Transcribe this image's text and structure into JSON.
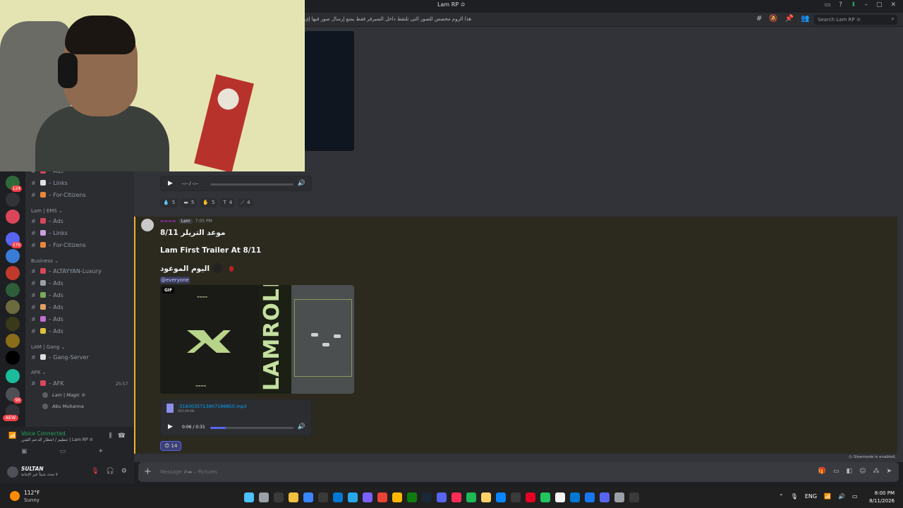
{
  "window": {
    "title": "Lam RP ♔",
    "controls": [
      "inbox-icon",
      "help-icon",
      "download-icon",
      "minimize-icon",
      "maximize-icon",
      "close-icon"
    ]
  },
  "header": {
    "topic": "هذا الروم مخصص للصور التي تلتقط داخل السيرفر فقط يمنع إرسال صور فيها إي",
    "icons": [
      "threads-icon",
      "mute-icon",
      "pin-icon",
      "members-icon"
    ],
    "search_placeholder": "Search Lam RP ♔"
  },
  "rail": {
    "badges": [
      "124",
      "376",
      "96"
    ],
    "new_label": "NEW"
  },
  "sidebar": {
    "top_channels": [
      {
        "label": "– Ads",
        "color": "#d9465a"
      },
      {
        "label": "– Links",
        "color": "#e0e0e0"
      },
      {
        "label": "– For-Citizens",
        "color": "#e8873a"
      }
    ],
    "categories": [
      {
        "name": "Lam | EMS",
        "channels": [
          {
            "label": "– Ads",
            "color": "#d9465a"
          },
          {
            "label": "– Links",
            "color": "#c9a0dc"
          },
          {
            "label": "– For-Citizens",
            "color": "#e8873a"
          }
        ]
      },
      {
        "name": "Business",
        "channels": [
          {
            "label": "– ALTAYYAN-Luxury",
            "color": "#d9465a"
          },
          {
            "label": "– Ads",
            "color": "#9aa0a6"
          },
          {
            "label": "– Ads",
            "color": "#7da95a"
          },
          {
            "label": "– Ads",
            "color": "#e0a060"
          },
          {
            "label": "– Ads",
            "color": "#c070d0"
          },
          {
            "label": "– Ads",
            "color": "#e0c040"
          }
        ]
      },
      {
        "name": "LAM | Gang",
        "channels": [
          {
            "label": "– Gang-Server",
            "color": "#dddddd"
          }
        ]
      },
      {
        "name": "AFK",
        "channels": [
          {
            "label": "– AFK",
            "color": "#d9465a"
          }
        ]
      }
    ],
    "afk_time": "25:57",
    "voice_users": [
      "Lam | Magic ♔",
      "Abu Muhanna"
    ]
  },
  "voice": {
    "status": "Voice Connected",
    "detail": "تنظيم / انتظار الدعم الفني | Lam RP ♔"
  },
  "user": {
    "name": "SULTAN",
    "status": "لا تحدد شيئاً غير الإجابة"
  },
  "messages": {
    "prev_audio": {
      "time": "-:-- / -:--",
      "progress": 0.0
    },
    "prev_reactions": [
      {
        "icon": "💧",
        "count": "5"
      },
      {
        "icon": "▬",
        "count": "5"
      },
      {
        "icon": "✋",
        "count": "5"
      },
      {
        "icon": "T",
        "count": "4"
      },
      {
        "icon": "⟋",
        "count": "4"
      }
    ],
    "highlight": {
      "tag": "Lam",
      "time": "7:05 PM",
      "line1": "موعد التريلر 8/11",
      "line2": "Lam First Trailer At 8/11",
      "line3": "اليوم الموعود",
      "mention": "@everyone",
      "gif_tag": "GIF",
      "gif_brand": "LAMROLE",
      "attachment": {
        "filename": "-3183035713907196850.mp3",
        "size": "691.09 KB",
        "time": "0:06 / 0:31",
        "progress": 0.19
      },
      "reaction": {
        "icon": "😊",
        "count": "14"
      }
    }
  },
  "composer": {
    "slowmode": "Slowmode is enabled.",
    "placeholder": "Message #▬ – Pictures",
    "icons": [
      "gift-icon",
      "gif-icon",
      "sticker-icon",
      "emoji-icon",
      "apps-icon",
      "send-icon"
    ]
  },
  "taskbar": {
    "temp": "112°F",
    "condition": "Sunny",
    "lang": "ENG",
    "time": "8:00 PM",
    "date": "8/11/2026",
    "app_colors": [
      "#4cc2ff",
      "#9aa0a6",
      "#3a3a3a",
      "#f0c040",
      "#3a86ff",
      "#3a3a3a",
      "#0078d4",
      "#28a8ea",
      "#7b61ff",
      "#ea4335",
      "#ffb900",
      "#107c10",
      "#1b2838",
      "#5865f2",
      "#ff2d55",
      "#1db954",
      "#ffd166",
      "#0a84ff",
      "#3a3a3a",
      "#e60023",
      "#22c55e",
      "#f5f5f5",
      "#0078d4",
      "#1877f2",
      "#5865f2",
      "#9aa0a6",
      "#3a3a3a"
    ]
  }
}
